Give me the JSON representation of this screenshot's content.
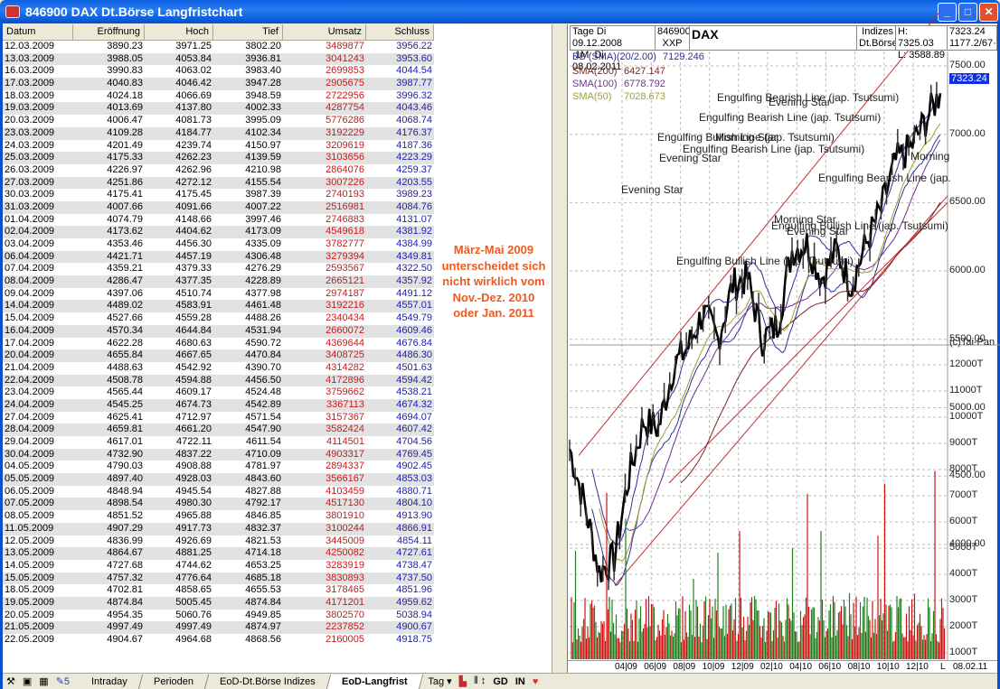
{
  "window": {
    "title": "846900 DAX Dt.Börse Langfristchart",
    "buttons": [
      "_",
      "□",
      "✕"
    ]
  },
  "table": {
    "columns": [
      "Datum",
      "Eröffnung",
      "Hoch",
      "Tief",
      "Umsatz",
      "Schluss"
    ],
    "rows": [
      [
        "12.03.2009",
        "3890.23",
        "3971.25",
        "3802.20",
        "3489877",
        "3956.22"
      ],
      [
        "13.03.2009",
        "3988.05",
        "4053.84",
        "3936.81",
        "3041243",
        "3953.60"
      ],
      [
        "16.03.2009",
        "3990.83",
        "4063.02",
        "3983.40",
        "2699853",
        "4044.54"
      ],
      [
        "17.03.2009",
        "4040.83",
        "4046.42",
        "3947.28",
        "2905675",
        "3987.77"
      ],
      [
        "18.03.2009",
        "4024.18",
        "4066.69",
        "3948.59",
        "2722956",
        "3996.32"
      ],
      [
        "19.03.2009",
        "4013.69",
        "4137.80",
        "4002.33",
        "4287754",
        "4043.46"
      ],
      [
        "20.03.2009",
        "4006.47",
        "4081.73",
        "3995.09",
        "5776286",
        "4068.74"
      ],
      [
        "23.03.2009",
        "4109.28",
        "4184.77",
        "4102.34",
        "3192229",
        "4176.37"
      ],
      [
        "24.03.2009",
        "4201.49",
        "4239.74",
        "4150.97",
        "3209619",
        "4187.36"
      ],
      [
        "25.03.2009",
        "4175.33",
        "4262.23",
        "4139.59",
        "3103656",
        "4223.29"
      ],
      [
        "26.03.2009",
        "4226.97",
        "4262.96",
        "4210.98",
        "2864076",
        "4259.37"
      ],
      [
        "27.03.2009",
        "4251.86",
        "4272.12",
        "4155.54",
        "3007226",
        "4203.55"
      ],
      [
        "30.03.2009",
        "4175.41",
        "4175.45",
        "3987.39",
        "2740193",
        "3989.23"
      ],
      [
        "31.03.2009",
        "4007.66",
        "4091.66",
        "4007.22",
        "2516981",
        "4084.76"
      ],
      [
        "01.04.2009",
        "4074.79",
        "4148.66",
        "3997.46",
        "2746883",
        "4131.07"
      ],
      [
        "02.04.2009",
        "4173.62",
        "4404.62",
        "4173.09",
        "4549618",
        "4381.92"
      ],
      [
        "03.04.2009",
        "4353.46",
        "4456.30",
        "4335.09",
        "3782777",
        "4384.99"
      ],
      [
        "06.04.2009",
        "4421.71",
        "4457.19",
        "4306.48",
        "3279394",
        "4349.81"
      ],
      [
        "07.04.2009",
        "4359.21",
        "4379.33",
        "4276.29",
        "2593567",
        "4322.50"
      ],
      [
        "08.04.2009",
        "4286.47",
        "4377.35",
        "4228.89",
        "2665121",
        "4357.92"
      ],
      [
        "09.04.2009",
        "4397.06",
        "4510.74",
        "4377.98",
        "2974187",
        "4491.12"
      ],
      [
        "14.04.2009",
        "4489.02",
        "4583.91",
        "4461.48",
        "3192216",
        "4557.01"
      ],
      [
        "15.04.2009",
        "4527.66",
        "4559.28",
        "4488.26",
        "2340434",
        "4549.79"
      ],
      [
        "16.04.2009",
        "4570.34",
        "4644.84",
        "4531.94",
        "2660072",
        "4609.46"
      ],
      [
        "17.04.2009",
        "4622.28",
        "4680.63",
        "4590.72",
        "4369644",
        "4676.84"
      ],
      [
        "20.04.2009",
        "4655.84",
        "4667.65",
        "4470.84",
        "3408725",
        "4486.30"
      ],
      [
        "21.04.2009",
        "4488.63",
        "4542.92",
        "4390.70",
        "4314282",
        "4501.63"
      ],
      [
        "22.04.2009",
        "4508.78",
        "4594.88",
        "4456.50",
        "4172896",
        "4594.42"
      ],
      [
        "23.04.2009",
        "4565.44",
        "4609.17",
        "4524.48",
        "3759662",
        "4538.21"
      ],
      [
        "24.04.2009",
        "4545.25",
        "4674.73",
        "4542.89",
        "3367113",
        "4674.32"
      ],
      [
        "27.04.2009",
        "4625.41",
        "4712.97",
        "4571.54",
        "3157367",
        "4694.07"
      ],
      [
        "28.04.2009",
        "4659.81",
        "4661.20",
        "4547.90",
        "3582424",
        "4607.42"
      ],
      [
        "29.04.2009",
        "4617.01",
        "4722.11",
        "4611.54",
        "4114501",
        "4704.56"
      ],
      [
        "30.04.2009",
        "4732.90",
        "4837.22",
        "4710.09",
        "4903317",
        "4769.45"
      ],
      [
        "04.05.2009",
        "4790.03",
        "4908.88",
        "4781.97",
        "2894337",
        "4902.45"
      ],
      [
        "05.05.2009",
        "4897.40",
        "4928.03",
        "4843.60",
        "3566167",
        "4853.03"
      ],
      [
        "06.05.2009",
        "4848.94",
        "4945.54",
        "4827.88",
        "4103459",
        "4880.71"
      ],
      [
        "07.05.2009",
        "4898.54",
        "4980.30",
        "4792.17",
        "4517130",
        "4804.10"
      ],
      [
        "08.05.2009",
        "4851.52",
        "4965.88",
        "4846.85",
        "3801910",
        "4913.90"
      ],
      [
        "11.05.2009",
        "4907.29",
        "4917.73",
        "4832.37",
        "3100244",
        "4866.91"
      ],
      [
        "12.05.2009",
        "4836.99",
        "4926.69",
        "4821.53",
        "3445009",
        "4854.11"
      ],
      [
        "13.05.2009",
        "4864.67",
        "4881.25",
        "4714.18",
        "4250082",
        "4727.61"
      ],
      [
        "14.05.2009",
        "4727.68",
        "4744.62",
        "4653.25",
        "3283919",
        "4738.47"
      ],
      [
        "15.05.2009",
        "4757.32",
        "4776.64",
        "4685.18",
        "3830893",
        "4737.50"
      ],
      [
        "18.05.2009",
        "4702.81",
        "4858.65",
        "4655.53",
        "3178465",
        "4851.96"
      ],
      [
        "19.05.2009",
        "4874.84",
        "5005.45",
        "4874.84",
        "4171201",
        "4959.62"
      ],
      [
        "20.05.2009",
        "4954.35",
        "5060.76",
        "4949.85",
        "3802570",
        "5038.94"
      ],
      [
        "21.05.2009",
        "4997.49",
        "4997.49",
        "4874.97",
        "2237852",
        "4900.67"
      ],
      [
        "22.05.2009",
        "4904.67",
        "4964.68",
        "4868.56",
        "2160005",
        "4918.75"
      ]
    ]
  },
  "note": {
    "lines": [
      "März-Mai 2009",
      "unterscheidet sich",
      "nicht wirklich vom",
      "Nov.-Dez. 2010",
      "oder Jan. 2011"
    ],
    "color": "#f05a1e"
  },
  "chart": {
    "header": {
      "period_label": "Tage",
      "from": "Di 09.12.2008",
      "interval": "1M",
      "to": "Di 08.02.2011",
      "wkn": "846900",
      "exchange_code": "XXP",
      "name": "DAX",
      "category": "Indizes",
      "market": "Dt.Börse",
      "high": "H: 7325.03",
      "low": "L: 3588.89",
      "last": "7323.24",
      "extra": "1177.2/67·"
    },
    "legend": [
      {
        "name": "BB (SMA)(20/2.00)",
        "value": "7129.246",
        "color": "#303090"
      },
      {
        "name": "SMA(200)",
        "value": "6427.147",
        "color": "#802020"
      },
      {
        "name": "SMA(100)",
        "value": "6778.792",
        "color": "#703090"
      },
      {
        "name": "SMA(50)",
        "value": "7028.673",
        "color": "#a0a030"
      }
    ],
    "price_axis": [
      "7500.00",
      "7000.00",
      "6500.00",
      "6000.00",
      "5500.00",
      "5000.00",
      "4500.00",
      "4000.00"
    ],
    "current_price": "7323.24",
    "copyright": "(c)Tai-Pan",
    "volume_axis": [
      "12000T",
      "11000T",
      "10000T",
      "9000T",
      "8000T",
      "7000T",
      "6000T",
      "5000T",
      "4000T",
      "3000T",
      "2000T",
      "1000T"
    ],
    "x_axis": [
      "04|09",
      "06|09",
      "08|09",
      "10|09",
      "12|09",
      "02|10",
      "04|10",
      "06|10",
      "08|10",
      "10|10",
      "12|10"
    ],
    "x_mode": "L",
    "x_end": "08.02.11",
    "patterns": [
      "Engulfing Bearish Line (jap. Tsutsumi)",
      "Evening Star",
      "Engulfing Bearish Line (jap. Tsutsumi)",
      "Engulfing Bullish Line (jap. Tsutsumi)",
      "Morning Star",
      "Engulfing Bearish Line (jap. Tsutsumi)",
      "Evening Star",
      "Morning",
      "Engulfing Bearish Line (jap.",
      "Evening Star",
      "Morning Star",
      "Engulfing Bullish Line (jap. Tsutsumi)",
      "Evening Star",
      "Engulfing Bullish Line (jap. Tsutsumi)"
    ],
    "price_monthly_approx": [
      4700,
      4300,
      3800,
      3900,
      4500,
      4900,
      4850,
      5300,
      5450,
      5700,
      5500,
      5900,
      5950,
      5500,
      5600,
      6150,
      6200,
      5950,
      6150,
      5900,
      6200,
      6450,
      6800,
      6900,
      7100,
      7300
    ]
  },
  "bottombar": {
    "tool_count": "5",
    "tabs": [
      "Intraday",
      "Perioden",
      "EoD-Dt.Börse Indizes",
      "EoD-Langfrist"
    ],
    "period": "Tag ▾",
    "gd": "GD",
    "in": "IN"
  }
}
